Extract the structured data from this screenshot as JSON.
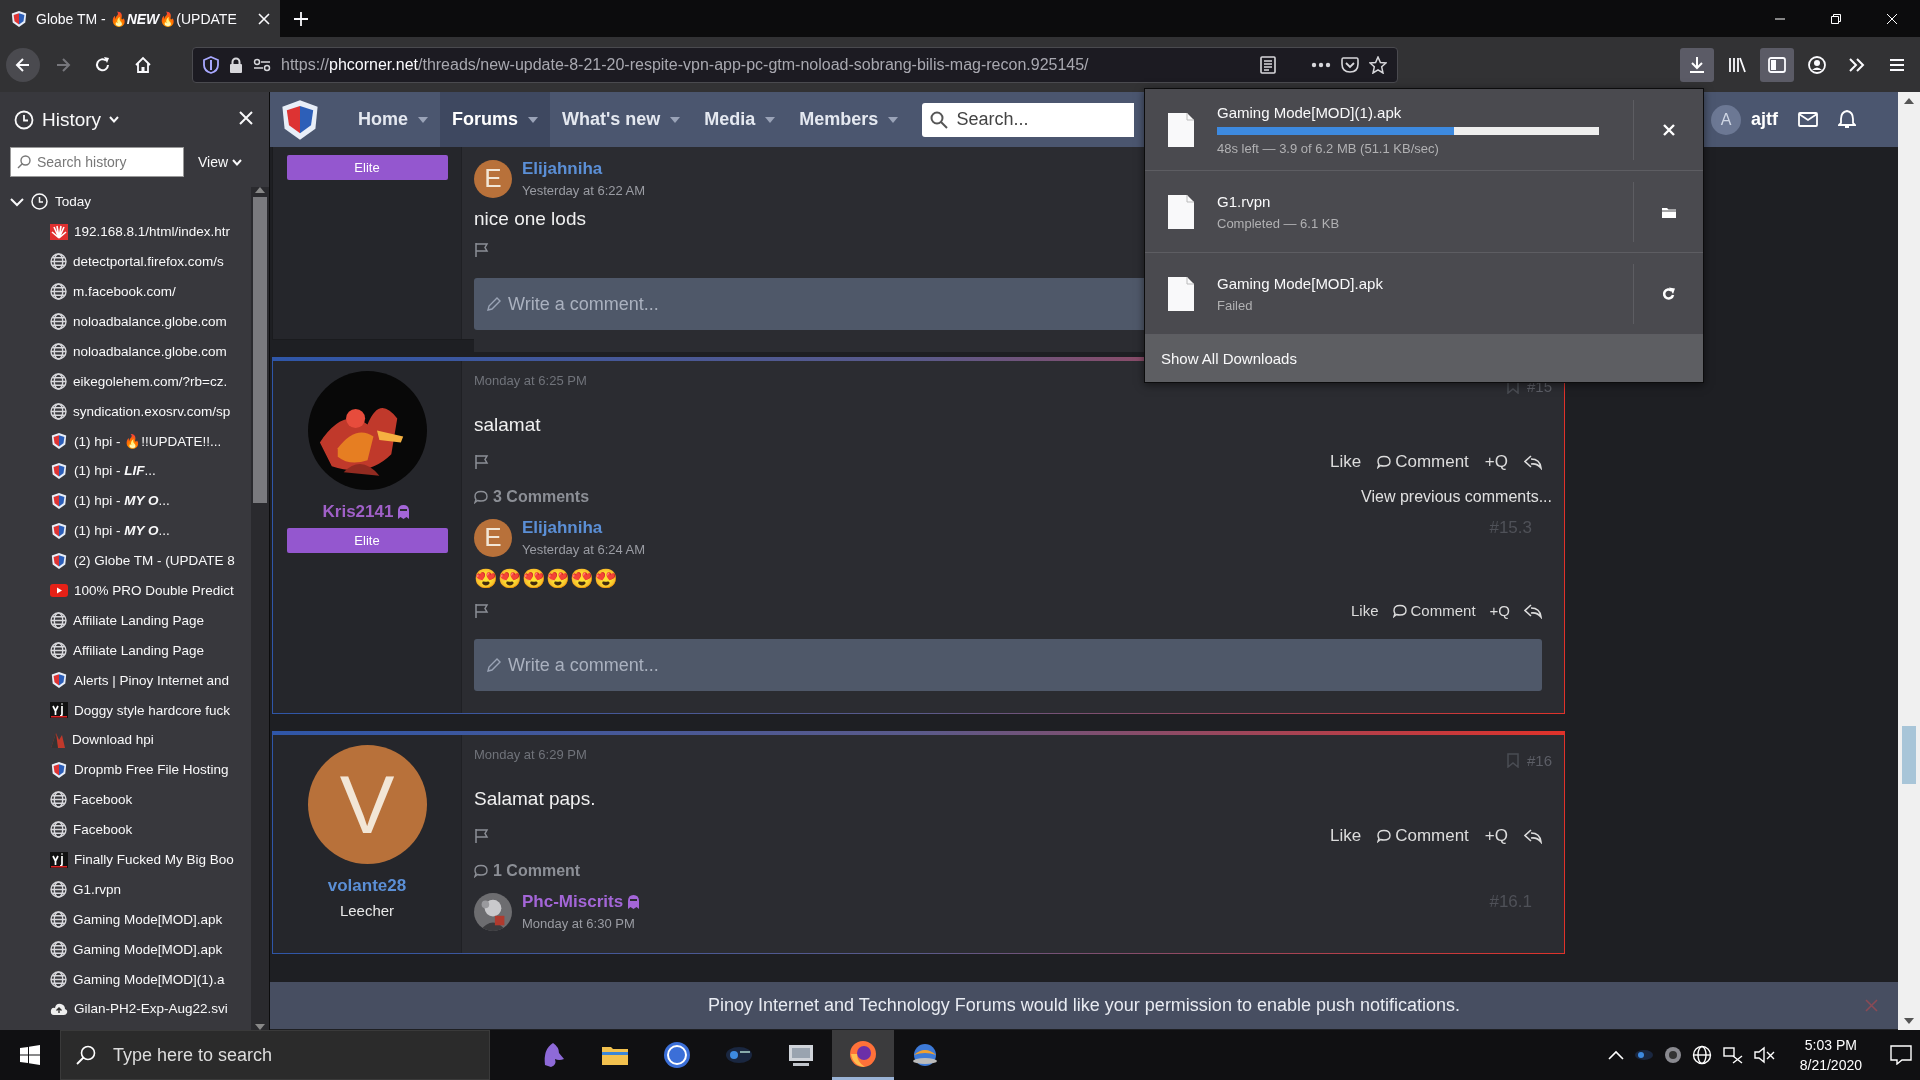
{
  "browser_tab": {
    "title": "Globe TM - 🔥**NEW**🔥(UPDATE",
    "selected": true
  },
  "toolbar": {
    "nav_buttons": [
      {
        "kind": "back",
        "disabled": false
      },
      {
        "kind": "forward",
        "disabled": true
      },
      {
        "kind": "reload",
        "disabled": false
      },
      {
        "kind": "home",
        "disabled": false
      }
    ],
    "url": {
      "scheme": "https://",
      "host": "phcorner.net",
      "path": "/threads/new-update-8-21-20-respite-vpn-app-pc-gtm-noload-sobrang-bilis-mag-recon.925145/"
    },
    "tool_buttons": [
      {
        "kind": "downloads",
        "on": true
      },
      {
        "kind": "library",
        "on": false
      },
      {
        "kind": "sidebar",
        "on": true
      },
      {
        "kind": "account",
        "on": false
      },
      {
        "kind": "overflow",
        "on": false
      },
      {
        "kind": "menu",
        "on": false
      }
    ]
  },
  "history": {
    "title": "History",
    "search_placeholder": "Search history",
    "view_label": "View",
    "groups": [
      {
        "label": "Today",
        "expanded": true,
        "children": [
          {
            "kind": "huawei",
            "title": "192.168.8.1/html/index.htr"
          },
          {
            "kind": "globe",
            "title": "detectportal.firefox.com/s"
          },
          {
            "kind": "globe",
            "title": "m.facebook.com/"
          },
          {
            "kind": "globe",
            "title": "noloadbalance.globe.com"
          },
          {
            "kind": "globe",
            "title": "noloadbalance.globe.com"
          },
          {
            "kind": "globe",
            "title": "eikegolehem.com/?rb=cz."
          },
          {
            "kind": "globe",
            "title": "syndication.exosrv.com/sp"
          },
          {
            "kind": "phc",
            "title": "(1) hpi - 🔥!!UPDATE!!..."
          },
          {
            "kind": "phc",
            "title": "(1) hpi - **LIF**..."
          },
          {
            "kind": "phc",
            "title": "(1) hpi - **MY O**..."
          },
          {
            "kind": "phc",
            "title": "(1) hpi - **MY O**..."
          },
          {
            "kind": "phc",
            "title": "(2) Globe TM - (UPDATE 8"
          },
          {
            "kind": "youtube",
            "title": "100% PRO Double Predict"
          },
          {
            "kind": "globe",
            "title": "Affiliate Landing Page"
          },
          {
            "kind": "globe",
            "title": "Affiliate Landing Page"
          },
          {
            "kind": "phc",
            "title": "Alerts | Pinoy Internet and"
          },
          {
            "kind": "yj",
            "title": "Doggy style hardcore fuck"
          },
          {
            "kind": "hpi",
            "title": "Download hpi"
          },
          {
            "kind": "phc",
            "title": "Dropmb Free File Hosting"
          },
          {
            "kind": "globe",
            "title": "Facebook"
          },
          {
            "kind": "globe",
            "title": "Facebook"
          },
          {
            "kind": "yj",
            "title": "Finally Fucked My Big Boo"
          },
          {
            "kind": "globe",
            "title": "G1.rvpn"
          },
          {
            "kind": "globe",
            "title": "Gaming Mode[MOD].apk"
          },
          {
            "kind": "globe",
            "title": "Gaming Mode[MOD].apk"
          },
          {
            "kind": "globe",
            "title": "Gaming Mode[MOD](1).a"
          },
          {
            "kind": "cloud",
            "title": "Gilan-PH2-Exp-Aug22.svi"
          }
        ]
      }
    ]
  },
  "site": {
    "nav": [
      {
        "label": "Home",
        "selected": false
      },
      {
        "label": "Forums",
        "selected": true
      },
      {
        "label": "What's new",
        "selected": false
      },
      {
        "label": "Media",
        "selected": false
      },
      {
        "label": "Members",
        "selected": false
      }
    ],
    "search_placeholder": "Search...",
    "account": {
      "avatar_letter": "A",
      "name": "ajtf"
    }
  },
  "posts": [
    {
      "user": {
        "rank": {
          "kind": "badge",
          "label": "Elite"
        }
      },
      "comments": [
        {
          "author": "Elijahniha",
          "color": "#5b8fd6",
          "group_icon": false,
          "avatar": {
            "kind": "letter",
            "letter": "E"
          },
          "date": "Yesterday at 6:22 AM",
          "body": "nice one lods"
        }
      ],
      "write_placeholder": "Write a comment..."
    },
    {
      "user": {
        "name": "Kris2141",
        "color": "#a060c8",
        "group_icon": true,
        "rank": {
          "kind": "badge",
          "label": "Elite"
        }
      },
      "date": "Monday at 6:25 PM",
      "number": "#15",
      "body": "salamat",
      "actions": [
        {
          "kind": "like",
          "label": "Like"
        },
        {
          "kind": "comment",
          "label": "Comment"
        },
        {
          "kind": "quote",
          "label": "+Q"
        },
        {
          "kind": "share"
        }
      ],
      "comments_header": "3 Comments",
      "view_previous": "View previous comments...",
      "comments": [
        {
          "author": "Elijahniha",
          "color": "#5b8fd6",
          "group_icon": false,
          "avatar": {
            "kind": "letter",
            "letter": "E"
          },
          "date": "Yesterday at 6:24 AM",
          "number": "#15.3",
          "body": "😍😍😍😍😍😍",
          "actions": [
            {
              "kind": "like",
              "label": "Like"
            },
            {
              "kind": "comment",
              "label": "Comment"
            },
            {
              "kind": "quote",
              "label": "+Q"
            },
            {
              "kind": "share"
            }
          ]
        }
      ],
      "write_placeholder": "Write a comment..."
    },
    {
      "user": {
        "name": "volante28",
        "color": "#5b8fd6",
        "group_icon": false,
        "avatar": {
          "kind": "letter",
          "letter": "V"
        },
        "rank": {
          "kind": "text",
          "label": "Leecher"
        }
      },
      "date": "Monday at 6:29 PM",
      "number": "#16",
      "body": "Salamat paps.",
      "actions": [
        {
          "kind": "like",
          "label": "Like"
        },
        {
          "kind": "comment",
          "label": "Comment"
        },
        {
          "kind": "quote",
          "label": "+Q"
        },
        {
          "kind": "share"
        }
      ],
      "comments_header": "1 Comment",
      "comments": [
        {
          "author": "Phc-Miscrits",
          "color": "#a466d8",
          "group_icon": true,
          "date": "Monday at 6:30 PM",
          "number": "#16.1"
        }
      ]
    }
  ],
  "push_notice": {
    "text": "Pinoy Internet and Technology Forums would like your permission to enable push notifications."
  },
  "downloads": {
    "items": [
      {
        "kind": "in_progress",
        "name": "Gaming Mode[MOD](1).apk",
        "status": "48s left — 3.9 of 6.2 MB (51.1 KB/sec)",
        "level": 0.62
      },
      {
        "kind": "completed",
        "name": "G1.rvpn",
        "status": "Completed — 6.1 KB"
      },
      {
        "kind": "failed",
        "name": "Gaming Mode[MOD].apk",
        "status": "Failed"
      }
    ],
    "footer": "Show All Downloads"
  },
  "taskbar": {
    "search_placeholder": "Type here to search",
    "apps": [
      {
        "kind": "purple",
        "active": false
      },
      {
        "kind": "explorer",
        "active": false
      },
      {
        "kind": "hpi",
        "active": false
      },
      {
        "kind": "svi",
        "active": false
      },
      {
        "kind": "computer",
        "active": false
      },
      {
        "kind": "firefox",
        "active": true
      },
      {
        "kind": "network",
        "active": false
      }
    ],
    "time": "5:03 PM",
    "date": "8/21/2020"
  }
}
